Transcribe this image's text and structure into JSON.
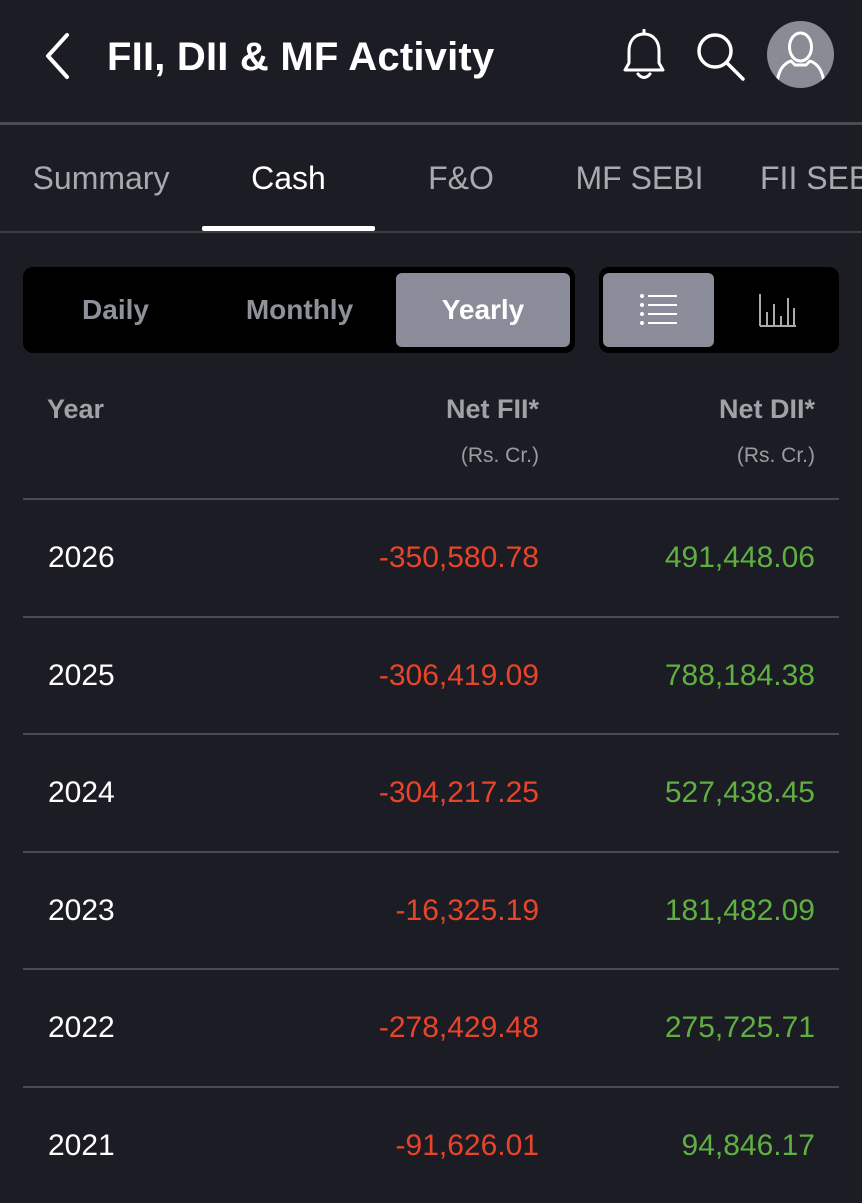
{
  "header": {
    "title": "FII, DII & MF Activity",
    "icons": [
      "back-icon",
      "bell-icon",
      "search-icon",
      "avatar-icon"
    ]
  },
  "tabs": [
    {
      "label": "Summary",
      "active": false
    },
    {
      "label": "Cash",
      "active": true
    },
    {
      "label": "F&O",
      "active": false
    },
    {
      "label": "MF SEBI",
      "active": false
    },
    {
      "label": "FII SEBI",
      "active": false
    }
  ],
  "period": {
    "options": [
      "Daily",
      "Monthly",
      "Yearly"
    ],
    "selected": "Yearly"
  },
  "view": {
    "options": [
      "list-icon",
      "bar-chart-icon"
    ],
    "selected": "list-icon"
  },
  "table": {
    "columns": [
      {
        "label": "Year",
        "unit": ""
      },
      {
        "label": "Net FII*",
        "unit": "(Rs. Cr.)"
      },
      {
        "label": "Net DII*",
        "unit": "(Rs. Cr.)"
      }
    ],
    "rows": [
      {
        "year": "2026",
        "fii": "-350,580.78",
        "dii": "491,448.06"
      },
      {
        "year": "2025",
        "fii": "-306,419.09",
        "dii": "788,184.38"
      },
      {
        "year": "2024",
        "fii": "-304,217.25",
        "dii": "527,438.45"
      },
      {
        "year": "2023",
        "fii": "-16,325.19",
        "dii": "181,482.09"
      },
      {
        "year": "2022",
        "fii": "-278,429.48",
        "dii": "275,725.71"
      },
      {
        "year": "2021",
        "fii": "-91,626.01",
        "dii": "94,846.17"
      }
    ]
  },
  "colors": {
    "background": "#1c1c24",
    "negative": "#e8442a",
    "positive": "#5fb041",
    "active_segment": "#8b8c99"
  }
}
